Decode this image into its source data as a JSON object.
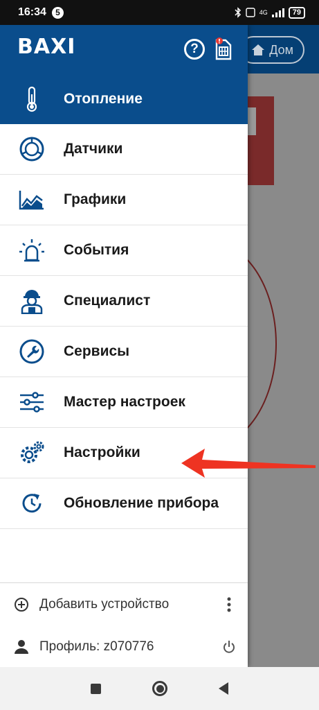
{
  "status_bar": {
    "time": "16:34",
    "notification_badge": "5",
    "network": "4G",
    "battery": "79"
  },
  "background_app": {
    "home_button_label": "Дом"
  },
  "drawer": {
    "logo": "BAXI",
    "help_label": "?",
    "accent_color": "#0a4d8c",
    "menu": [
      {
        "label": "Отопление",
        "icon": "thermometer-icon",
        "active": true
      },
      {
        "label": "Датчики",
        "icon": "sensors-icon"
      },
      {
        "label": "Графики",
        "icon": "chart-icon"
      },
      {
        "label": "События",
        "icon": "alarm-light-icon"
      },
      {
        "label": "Специалист",
        "icon": "technician-icon"
      },
      {
        "label": "Сервисы",
        "icon": "wrench-icon"
      },
      {
        "label": "Мастер настроек",
        "icon": "sliders-icon"
      },
      {
        "label": "Настройки",
        "icon": "gears-icon"
      },
      {
        "label": "Обновление прибора",
        "icon": "update-icon"
      }
    ],
    "footer": {
      "add_device": "Добавить устройство",
      "profile": "Профиль: z070776"
    }
  },
  "annotation": {
    "arrow_color": "#ee3322"
  }
}
